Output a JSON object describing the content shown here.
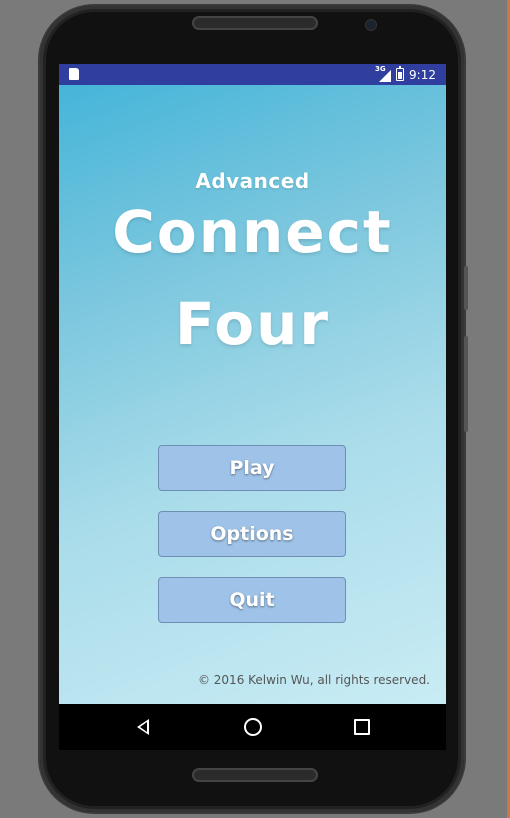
{
  "status_bar": {
    "network": "3G",
    "time": "9:12",
    "left_icon": "sd-card-icon",
    "signal_icon": "signal-icon",
    "battery_icon": "battery-charging-icon",
    "background_color": "#303f9f"
  },
  "title": {
    "small": "Advanced",
    "line1": "Connect",
    "line2": "Four"
  },
  "menu": {
    "play_label": "Play",
    "options_label": "Options",
    "quit_label": "Quit",
    "button_color": "#9fc3e8"
  },
  "footer": {
    "copyright": "© 2016 Kelwin Wu, all rights reserved."
  },
  "nav_bar": {
    "back_icon": "back-icon",
    "home_icon": "home-icon",
    "recent_icon": "recent-apps-icon"
  }
}
